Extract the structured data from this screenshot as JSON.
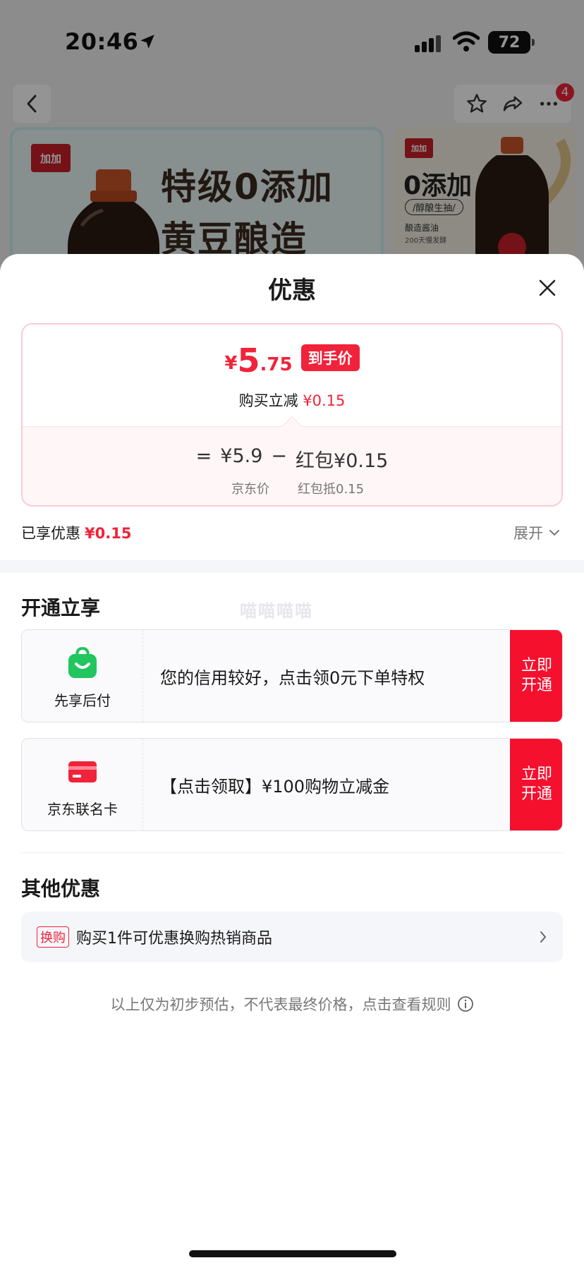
{
  "status": {
    "time": "20:46",
    "battery": "72"
  },
  "nav": {
    "badge_count": "4"
  },
  "banner": {
    "main_logo": "加加",
    "main_headline_1": "特级0添加",
    "main_headline_2": "黄豆酿造",
    "side_logo": "加加",
    "side_headline": "0添加",
    "side_tag": "/醇酿生抽/",
    "side_sub": "酿造酱油",
    "side_sub2": "200天慢发酵"
  },
  "sheet": {
    "title": "优惠",
    "price": {
      "currency": "¥",
      "integer": "5",
      "decimal": ".75",
      "tag": "到手价",
      "reduce_label": "购买立减",
      "reduce_value": "¥0.15"
    },
    "formula": {
      "equals": "=",
      "jd_price": "¥5.9",
      "minus": "−",
      "redpacket": "红包¥0.15",
      "jd_label": "京东价",
      "redpacket_label": "红包抵0.15"
    },
    "enjoyed": {
      "label": "已享优惠",
      "value": "¥0.15"
    },
    "expand_label": "展开",
    "open_section": {
      "title": "开通立享",
      "watermark": "喵喵喵喵",
      "offers": [
        {
          "name": "先享后付",
          "text": "您的信用较好，点击领0元下单特权",
          "btn_1": "立即",
          "btn_2": "开通"
        },
        {
          "name": "京东联名卡",
          "text": "【点击领取】¥100购物立减金",
          "btn_1": "立即",
          "btn_2": "开通"
        }
      ]
    },
    "other_section": {
      "title": "其他优惠",
      "tag": "换购",
      "text": "购买1件可优惠换购热销商品"
    },
    "disclaimer": "以上仅为初步预估，不代表最终价格，点击查看规则"
  },
  "colors": {
    "accent_red": "#f0233a",
    "button_red": "#f5102e",
    "green": "#22c55e"
  }
}
